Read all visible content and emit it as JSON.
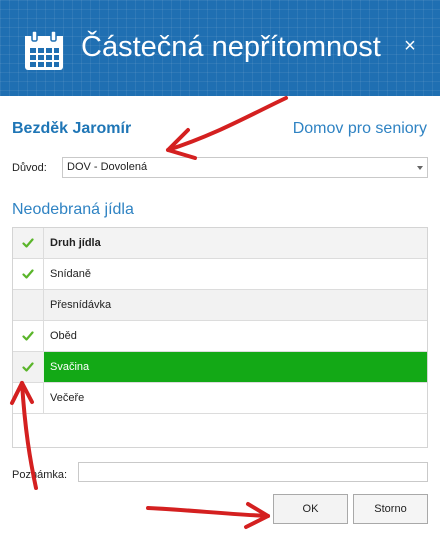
{
  "dialog": {
    "title": "Částečná nepřítomnost",
    "close_glyph": "×",
    "header_color": "#1f6fb2"
  },
  "person": {
    "name": "Bezděk Jaromír",
    "facility": "Domov pro seniory"
  },
  "reason": {
    "label": "Důvod:",
    "value": "DOV - Dovolená"
  },
  "meals": {
    "section_title": "Neodebraná jídla",
    "column_header": "Druh jídla",
    "header_checked": true,
    "rows": [
      {
        "label": "Snídaně",
        "checked": true,
        "selected": false
      },
      {
        "label": "Přesnídávka",
        "checked": false,
        "selected": false
      },
      {
        "label": "Oběd",
        "checked": true,
        "selected": false
      },
      {
        "label": "Svačina",
        "checked": true,
        "selected": true
      },
      {
        "label": "Večeře",
        "checked": false,
        "selected": false
      }
    ],
    "check_color": "#5ab52a",
    "selected_color": "#13a916"
  },
  "note": {
    "label": "Poznámka:",
    "value": ""
  },
  "buttons": {
    "ok": "OK",
    "cancel": "Storno"
  },
  "icons": {
    "header": "calendar-icon",
    "close": "close-icon",
    "check": "checkmark-icon",
    "dropdown": "chevron-down-icon"
  },
  "annotation_color": "#d42020"
}
